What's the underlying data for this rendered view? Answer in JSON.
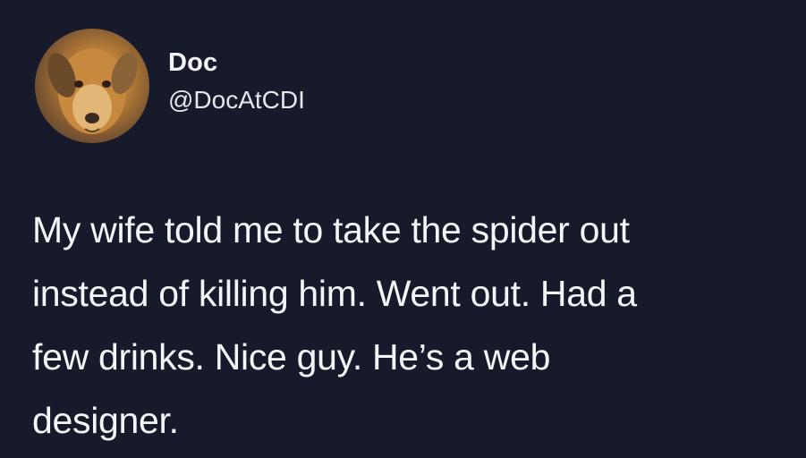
{
  "tweet": {
    "author": {
      "display_name": "Doc",
      "handle": "@DocAtCDI",
      "avatar_icon": "dog-avatar-icon"
    },
    "text_lines": [
      "My wife told me to take the spider out",
      "instead of killing him. Went out. Had a",
      "few drinks. Nice guy. He’s a web",
      "designer."
    ]
  },
  "colors": {
    "background": "#161a2b",
    "text": "#f4f5f7"
  }
}
